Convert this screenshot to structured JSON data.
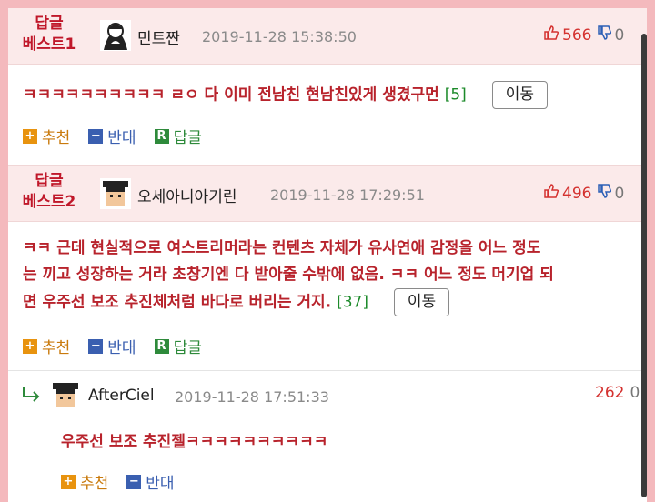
{
  "comments": [
    {
      "badge_top": "답글",
      "badge_bottom": "베스트1",
      "nickname": "민트짠",
      "date": "2019-11-28 15:38:50",
      "likes": "566",
      "dislikes": "0",
      "text": "ㅋㅋㅋㅋㅋㅋㅋㅋㅋㅋ ㄹㅇ 다 이미 전남친 현남친있게 생겼구먼",
      "reply_count": "[5]",
      "move_label": "이동",
      "recommend": "추천",
      "oppose": "반대",
      "reply": "답글"
    },
    {
      "badge_top": "답글",
      "badge_bottom": "베스트2",
      "nickname": "오세아니아기린",
      "date": "2019-11-28 17:29:51",
      "likes": "496",
      "dislikes": "0",
      "text_lines": [
        "ㅋㅋ 근데 현실적으로 여스트리머라는 컨텐츠 자체가 유사연애 감정을 어느 정도",
        "는 끼고 성장하는 거라 초창기엔 다 받아줄 수밖에 없음. ㅋㅋ 어느 정도 머기업 되",
        "면 우주선 보조 추진체처럼 바다로 버리는 거지."
      ],
      "reply_count": "[37]",
      "move_label": "이동",
      "recommend": "추천",
      "oppose": "반대",
      "reply": "답글"
    },
    {
      "nickname": "AfterCiel",
      "date": "2019-11-28 17:51:33",
      "likes": "262",
      "dislikes": "0",
      "text": "우주선 보조 추진젤ㅋㅋㅋㅋㅋㅋㅋㅋㅋㅋ",
      "recommend": "추천",
      "oppose": "반대"
    }
  ],
  "icons": {
    "plus": "+",
    "minus": "−",
    "reply_mark": "R"
  },
  "colors": {
    "background": "#f4b9bd",
    "header_bg": "#fbeaea",
    "badge_red": "#c0182a",
    "text_red": "#b8232c",
    "count_green": "#1c8a2a"
  }
}
